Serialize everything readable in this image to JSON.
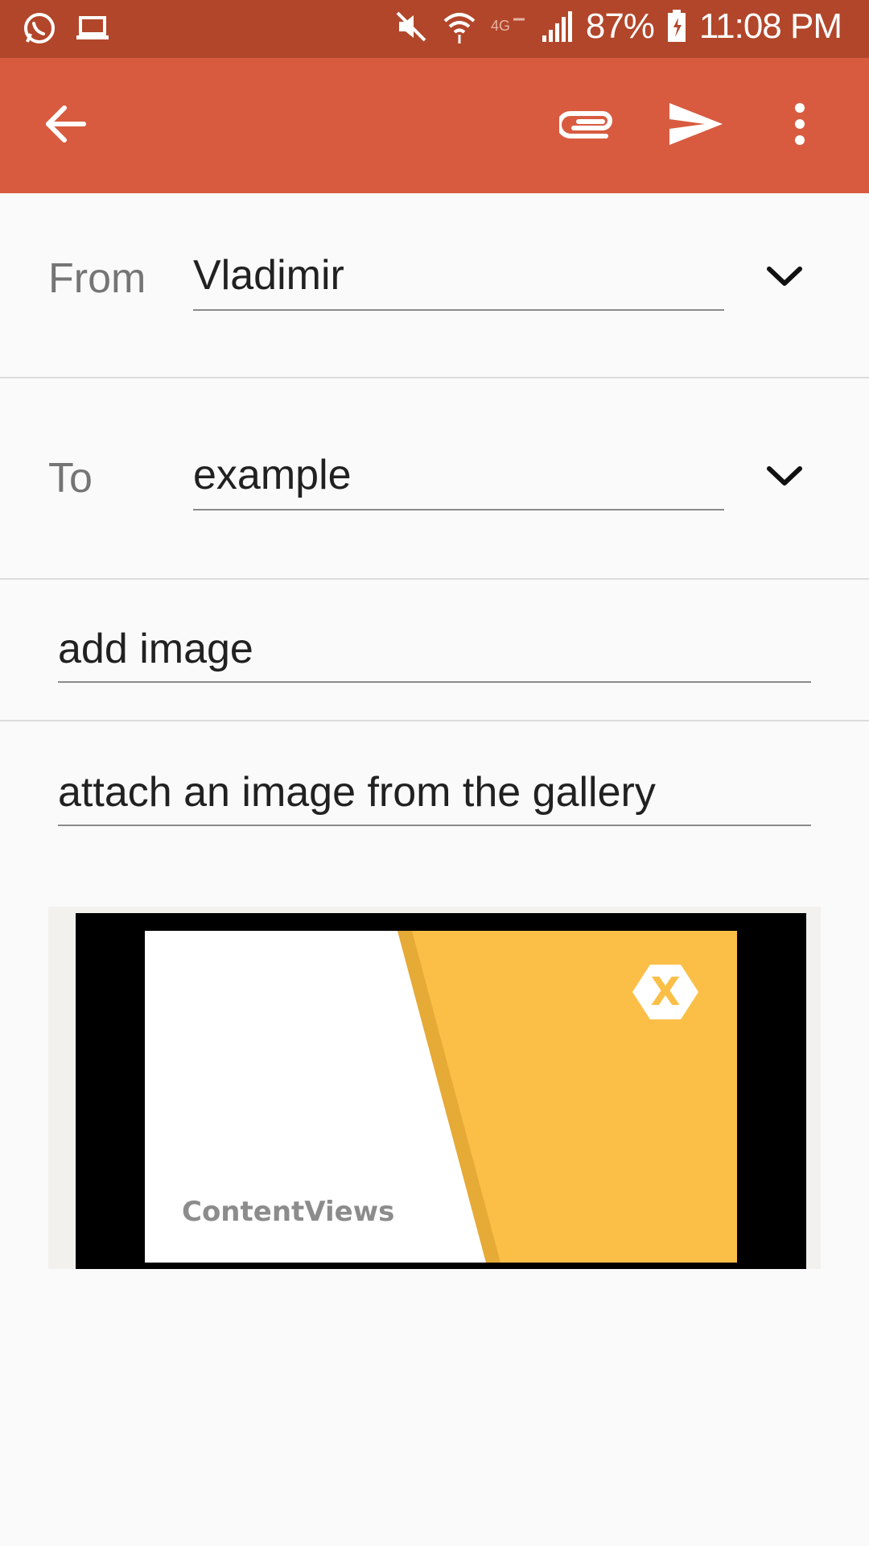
{
  "status_bar": {
    "battery": "87%",
    "time": "11:08 PM",
    "left_icons": [
      "whatsapp-icon",
      "laptop-icon"
    ],
    "right_icons": [
      "mute-icon",
      "wifi-icon",
      "data-icon",
      "signal-icon",
      "battery-icon"
    ]
  },
  "app_bar": {
    "background": "#d85b40",
    "actions": [
      "back-arrow-icon",
      "attach-icon",
      "send-icon",
      "overflow-menu-icon"
    ]
  },
  "compose": {
    "from_label": "From",
    "from_value": "Vladimir",
    "to_label": "To",
    "to_value": "example",
    "subject_value": "add image",
    "body_value": "attach an image from the gallery"
  },
  "attachment": {
    "image_caption": "ContentViews",
    "logo_letter": "X",
    "accent": "#fbbf47"
  }
}
